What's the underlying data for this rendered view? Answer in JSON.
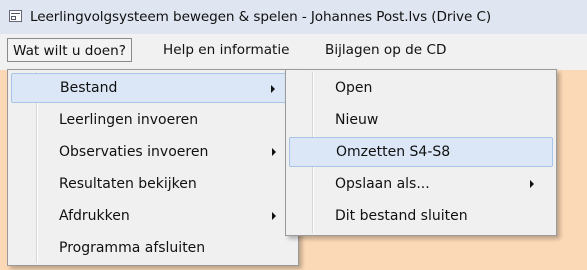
{
  "window": {
    "title": "Leerlingvolgsysteem bewegen & spelen - Johannes Post.lvs   (Drive C)",
    "icon": "app-icon"
  },
  "menubar": {
    "items": [
      "Wat wilt u doen?",
      "Help en informatie",
      "Bijlagen op de CD"
    ]
  },
  "main_menu": {
    "items": [
      {
        "label": "Bestand",
        "submenu": true,
        "highlighted": true
      },
      {
        "label": "Leerlingen invoeren",
        "submenu": false
      },
      {
        "label": "Observaties invoeren",
        "submenu": true
      },
      {
        "label": "Resultaten bekijken",
        "submenu": false
      },
      {
        "label": "Afdrukken",
        "submenu": true
      },
      {
        "label": "Programma afsluiten",
        "submenu": false
      }
    ]
  },
  "sub_menu": {
    "items": [
      {
        "label": "Open",
        "submenu": false
      },
      {
        "label": "Nieuw",
        "submenu": false
      },
      {
        "label": "Omzetten S4-S8",
        "submenu": false,
        "highlighted": true
      },
      {
        "label": "Opslaan als...",
        "submenu": true
      },
      {
        "label": "Dit bestand sluiten",
        "submenu": false
      }
    ]
  },
  "colors": {
    "desktop": "#fcd9b6",
    "titlebar": "#dfe6f1",
    "menu_bg": "#f0f0f0",
    "highlight": "#dbe7f6",
    "highlight_border": "#a8c4e8"
  }
}
